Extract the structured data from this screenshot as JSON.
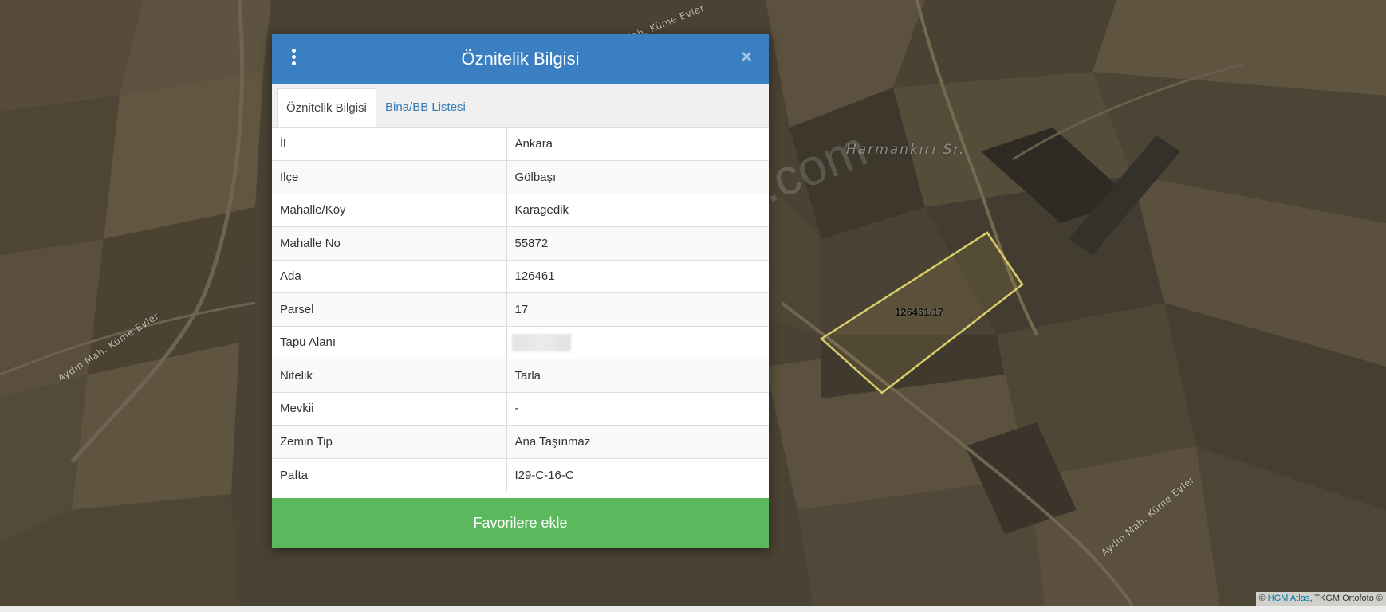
{
  "map": {
    "labels": {
      "road_top": "Aydın Mah. Küme Evler",
      "road_left": "Aydın Mah. Küme Evler",
      "road_bottom": "Aydın Mah. Küme Evler",
      "locality": "Harmankırı Sr.",
      "parcel": "126461/17",
      "watermark": "emlakjet.com"
    },
    "attribution": {
      "prefix": "© ",
      "link": "HGM Atlas",
      "rest": ", TKGM Ortofoto ©"
    }
  },
  "modal": {
    "title": "Öznitelik Bilgisi",
    "menu_icon": "vertical-ellipsis-icon",
    "close_icon": "close-icon",
    "close_glyph": "×",
    "tabs": [
      {
        "label": "Öznitelik Bilgisi",
        "active": true
      },
      {
        "label": "Bina/BB Listesi",
        "active": false
      }
    ],
    "rows": [
      {
        "key": "İl",
        "value": "Ankara"
      },
      {
        "key": "İlçe",
        "value": "Gölbaşı"
      },
      {
        "key": "Mahalle/Köy",
        "value": "Karagedik"
      },
      {
        "key": "Mahalle No",
        "value": "55872"
      },
      {
        "key": "Ada",
        "value": "126461"
      },
      {
        "key": "Parsel",
        "value": "17"
      },
      {
        "key": "Tapu Alanı",
        "value": ""
      },
      {
        "key": "Nitelik",
        "value": "Tarla"
      },
      {
        "key": "Mevkii",
        "value": "-"
      },
      {
        "key": "Zemin Tip",
        "value": "Ana Taşınmaz"
      },
      {
        "key": "Pafta",
        "value": "I29-C-16-C"
      }
    ],
    "favorite_button": "Favorilere ekle"
  },
  "colors": {
    "header": "#3a7fc1",
    "favorite_button": "#5cb85c",
    "tab_link": "#337ab7",
    "parcel_outline": "#d8cc6a"
  }
}
